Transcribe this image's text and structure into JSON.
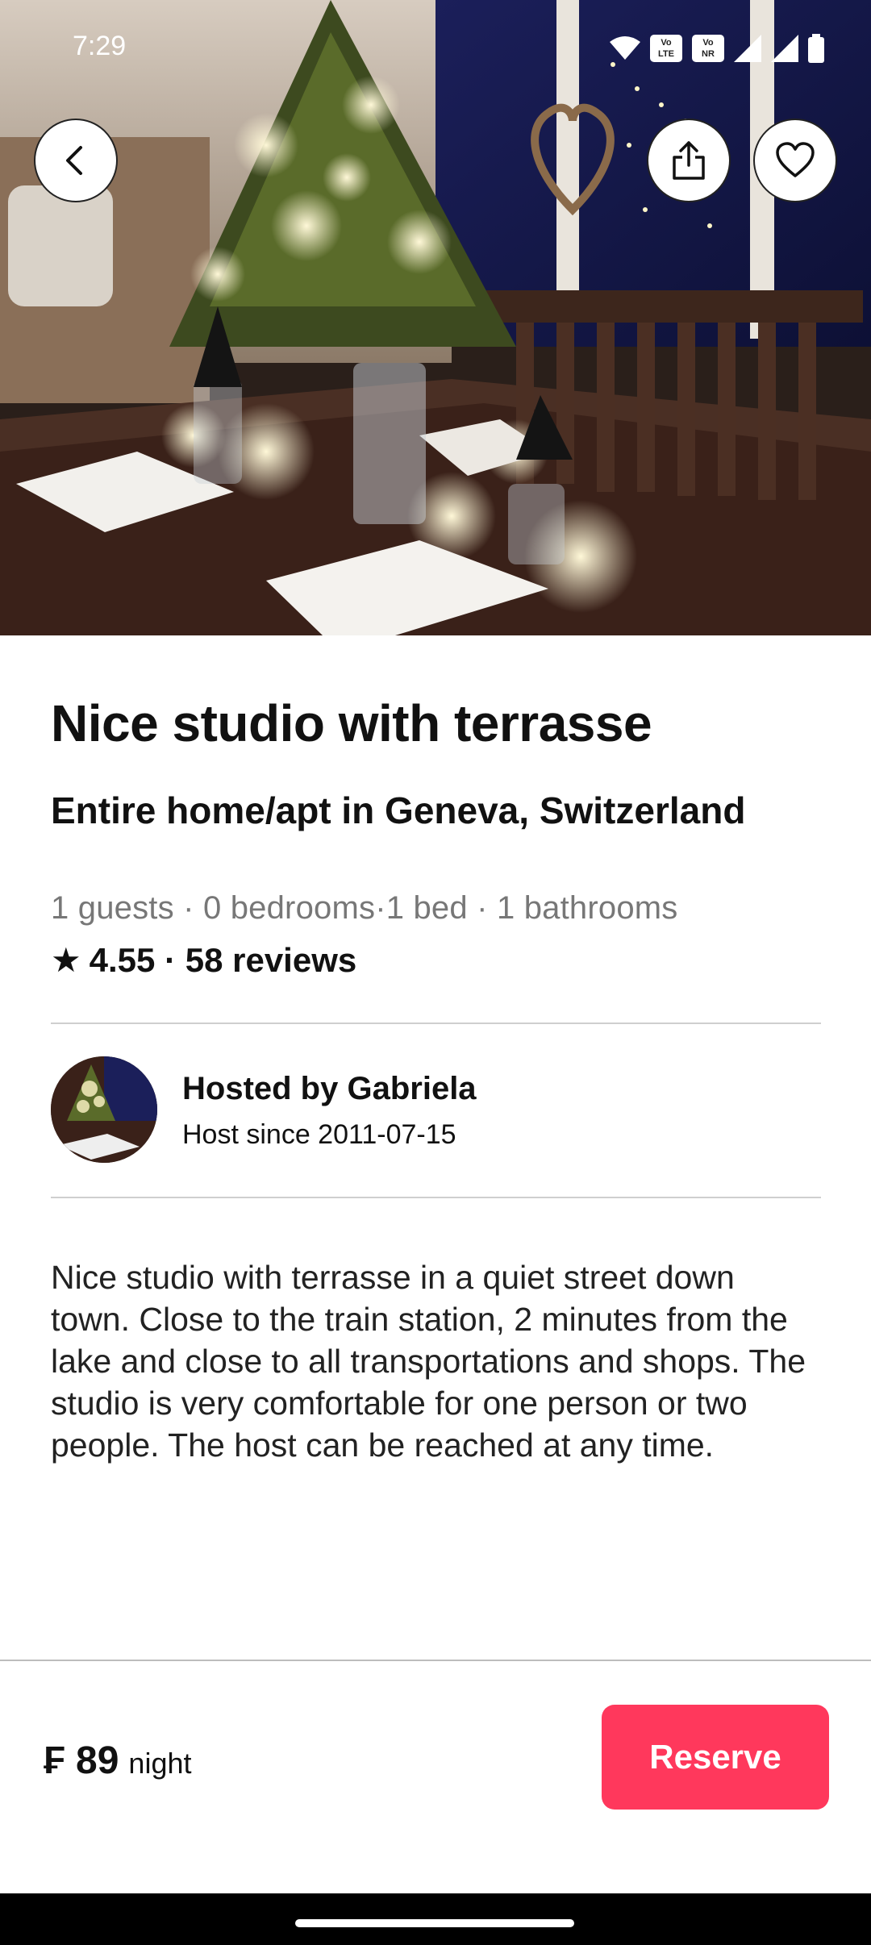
{
  "status_bar": {
    "time": "7:29",
    "badge_1": "Vo LTE 2",
    "badge_2": "Vo NR 1"
  },
  "hero": {
    "image": "christmas-tree-dinner-table-photo"
  },
  "header_buttons": {
    "back_icon": "chevron-left-icon",
    "share_icon": "share-icon",
    "favorite_icon": "heart-icon"
  },
  "listing": {
    "title": "Nice studio with terrasse",
    "subtitle": "Entire home/apt in Geneva, Switzerland",
    "details": "1 guests · 0 bedrooms·1 bed · 1 bathrooms",
    "rating_star": "★",
    "rating_text": "4.55 · 58 reviews"
  },
  "host": {
    "name": "Hosted by Gabriela",
    "since": "Host since 2011-07-15"
  },
  "description": "Nice studio with terrasse in a quiet street down town. Close to the train station, 2 minutes from the lake and close to all transportations and shops. The studio is very comfortable for one person or two people. The host can be reached at any time.",
  "booking": {
    "price": "₣ 89",
    "unit": "night",
    "reserve_label": "Reserve"
  },
  "colors": {
    "accent": "#ff385c",
    "text": "#111111",
    "muted": "#777777"
  }
}
